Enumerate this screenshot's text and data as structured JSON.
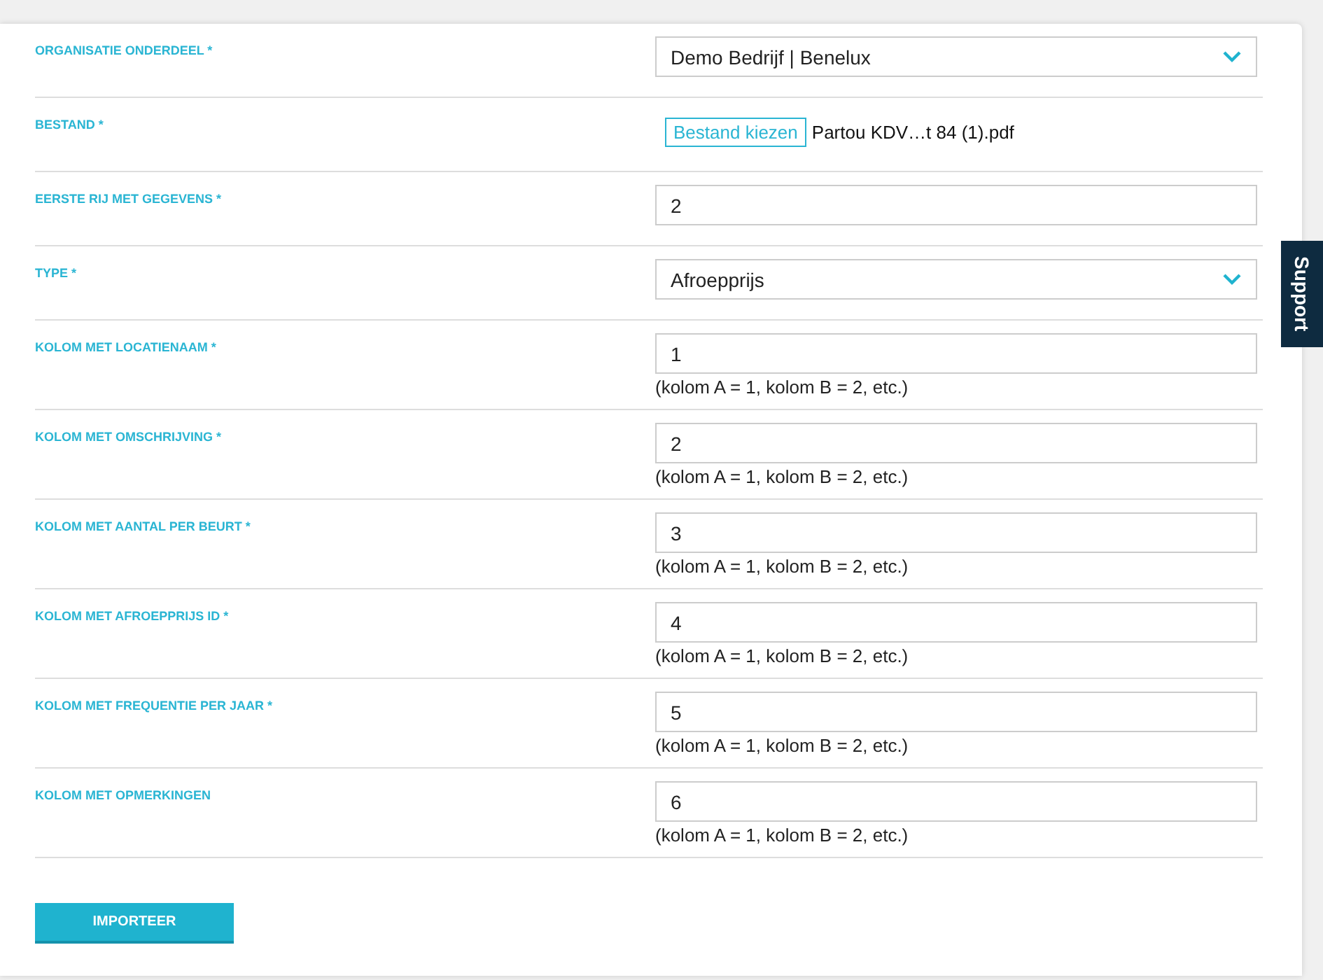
{
  "form": {
    "fields": [
      {
        "kind": "select",
        "label": "ORGANISATIE ONDERDEEL *",
        "value": "Demo Bedrijf | Benelux"
      },
      {
        "kind": "file",
        "label": "BESTAND *",
        "button": "Bestand kiezen",
        "filename": "Partou KDV…t 84 (1).pdf"
      },
      {
        "kind": "input",
        "label": "EERSTE RIJ MET GEGEVENS *",
        "value": "2"
      },
      {
        "kind": "select",
        "label": "TYPE *",
        "value": "Afroepprijs"
      },
      {
        "kind": "input",
        "label": "KOLOM MET LOCATIENAAM *",
        "value": "1",
        "hint": "(kolom A = 1, kolom B = 2, etc.)"
      },
      {
        "kind": "input",
        "label": "KOLOM MET OMSCHRIJVING *",
        "value": "2",
        "hint": "(kolom A = 1, kolom B = 2, etc.)"
      },
      {
        "kind": "input",
        "label": "KOLOM MET AANTAL PER BEURT *",
        "value": "3",
        "hint": "(kolom A = 1, kolom B = 2, etc.)"
      },
      {
        "kind": "input",
        "label": "KOLOM MET AFROEPPRIJS ID *",
        "value": "4",
        "hint": "(kolom A = 1, kolom B = 2, etc.)"
      },
      {
        "kind": "input",
        "label": "KOLOM MET FREQUENTIE PER JAAR *",
        "value": "5",
        "hint": "(kolom A = 1, kolom B = 2, etc.)"
      },
      {
        "kind": "input",
        "label": "KOLOM MET OPMERKINGEN",
        "value": "6",
        "hint": "(kolom A = 1, kolom B = 2, etc.)"
      }
    ],
    "submit": "IMPORTEER"
  },
  "support_tab": "Support"
}
